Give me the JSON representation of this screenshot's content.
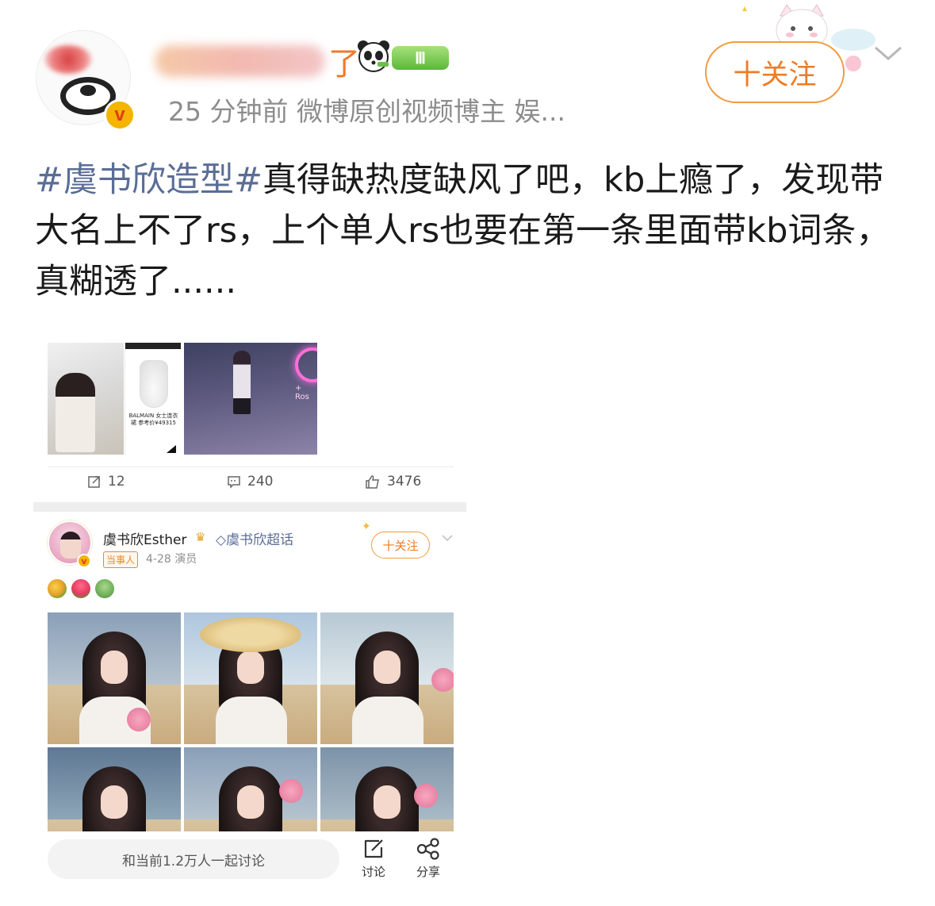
{
  "post": {
    "username_visible_suffix": "了",
    "level_badge": "Ⅲ",
    "meta": "25 分钟前  微博原创视频博主 娱...",
    "follow_label": "十关注",
    "topic": "#虞书欣造型#",
    "text": "真得缺热度缺风了吧，kb上瘾了，发现带大名上不了rs，上个单人rs也要在第一条里面带kb词条，真糊透了......"
  },
  "embedded_shot": {
    "thumb2_caption": "BALMAIN 女士连衣裙 参考价¥49315",
    "thumb3_sign": "+ Ros",
    "actions": {
      "repost": "12",
      "comments": "240",
      "likes": "3476"
    },
    "post2": {
      "author": "虞书欣Esther",
      "supertopic": "虞书欣超话",
      "tag": "当事人",
      "meta": "4-28  演员",
      "follow_label": "十关注"
    }
  },
  "bottom_bar": {
    "comment_placeholder": "和当前1.2万人一起讨论",
    "discuss_label": "讨论",
    "share_label": "分享"
  },
  "icons": [
    "v-verified-icon",
    "panda-icon",
    "chevron-down-icon",
    "repost-icon",
    "comment-icon",
    "like-icon",
    "edit-icon",
    "share-icon"
  ],
  "colors": {
    "accent": "#ee7b24",
    "topic": "#5a6d96",
    "meta": "#8d8d8d"
  }
}
